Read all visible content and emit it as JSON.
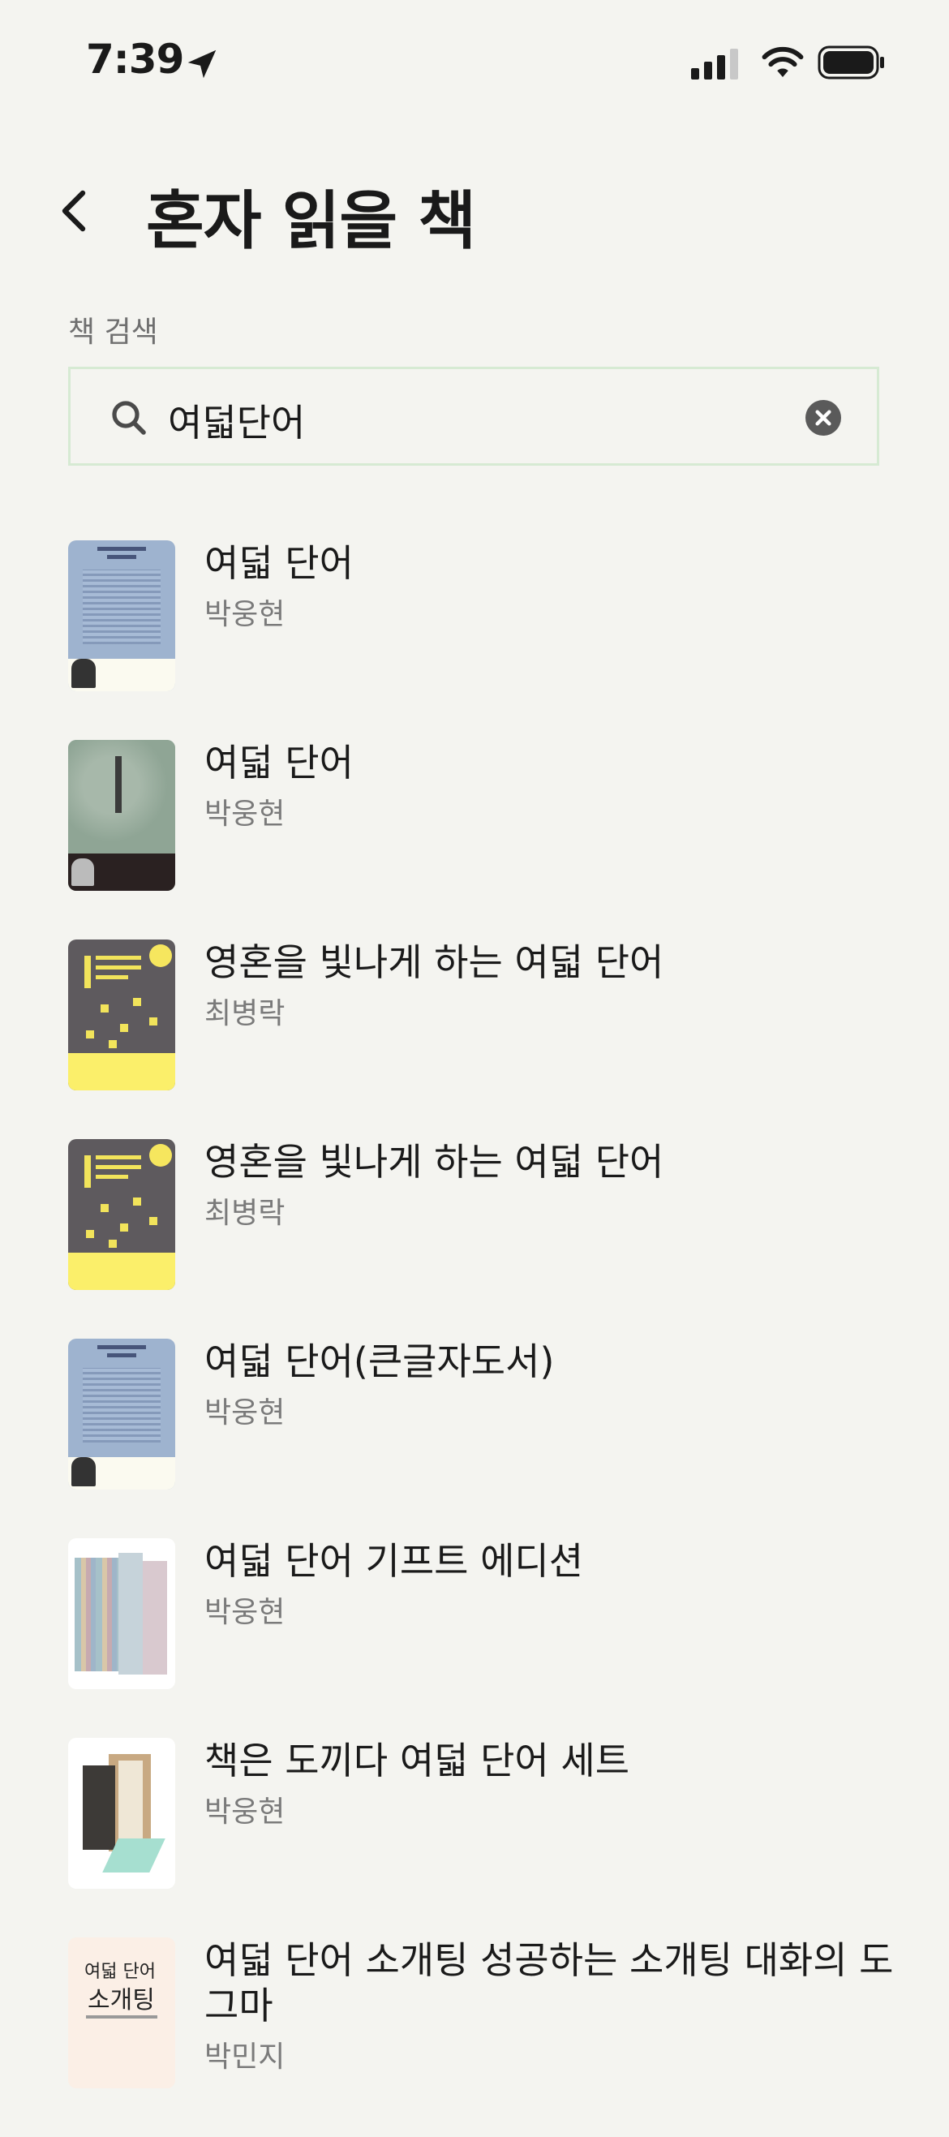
{
  "status_bar": {
    "time": "7:39"
  },
  "header": {
    "title": "혼자 읽을 책"
  },
  "search": {
    "label": "책 검색",
    "value": "여덟단어"
  },
  "results": [
    {
      "title": "여덟 단어",
      "author": "박웅현",
      "cover": "blue-moment"
    },
    {
      "title": "여덟 단어",
      "author": "박웅현",
      "cover": "green-vertical"
    },
    {
      "title": "영혼을 빛나게 하는 여덟 단어",
      "author": "최병락",
      "cover": "gray-yellow"
    },
    {
      "title": "영혼을 빛나게 하는 여덟 단어",
      "author": "최병락",
      "cover": "gray-yellow"
    },
    {
      "title": "여덟 단어(큰글자도서)",
      "author": "박웅현",
      "cover": "blue-moment"
    },
    {
      "title": "여덟 단어 기프트 에디션",
      "author": "박웅현",
      "cover": "gift-set"
    },
    {
      "title": "책은 도끼다 여덟 단어 세트",
      "author": "박웅현",
      "cover": "book-set"
    },
    {
      "title": "여덟 단어 소개팅  성공하는 소개팅 대화의 도그마",
      "author": "박민지",
      "cover": "date-cover",
      "cover_text": [
        "여덟 단어",
        "소개팅"
      ]
    }
  ]
}
